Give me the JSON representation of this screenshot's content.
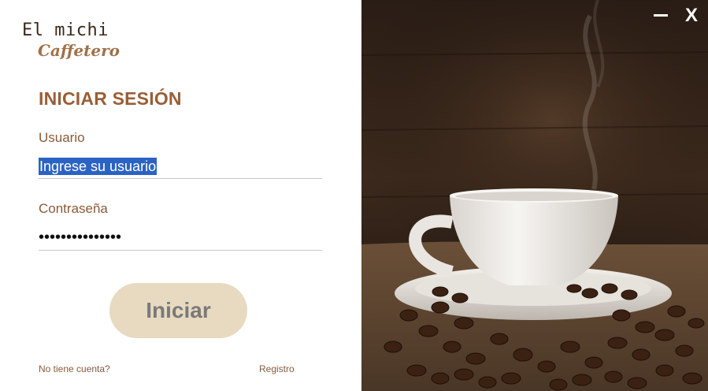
{
  "logo": {
    "line1": "El michi",
    "line2": "Caffetero"
  },
  "login": {
    "title": "INICIAR SESIÓN",
    "user_label": "Usuario",
    "user_value": "Ingrese su usuario",
    "password_label": "Contraseña",
    "password_value": "•••••••••••••••",
    "submit_label": "Iniciar",
    "no_account_label": "No tiene cuenta?",
    "register_label": "Registro"
  },
  "window": {
    "minimize_icon": "minimize-icon",
    "close_label": "X"
  },
  "colors": {
    "accent": "#9a5e37",
    "label": "#8a5a3a",
    "button_bg": "#e8dac0",
    "selection": "#2b63c4"
  }
}
